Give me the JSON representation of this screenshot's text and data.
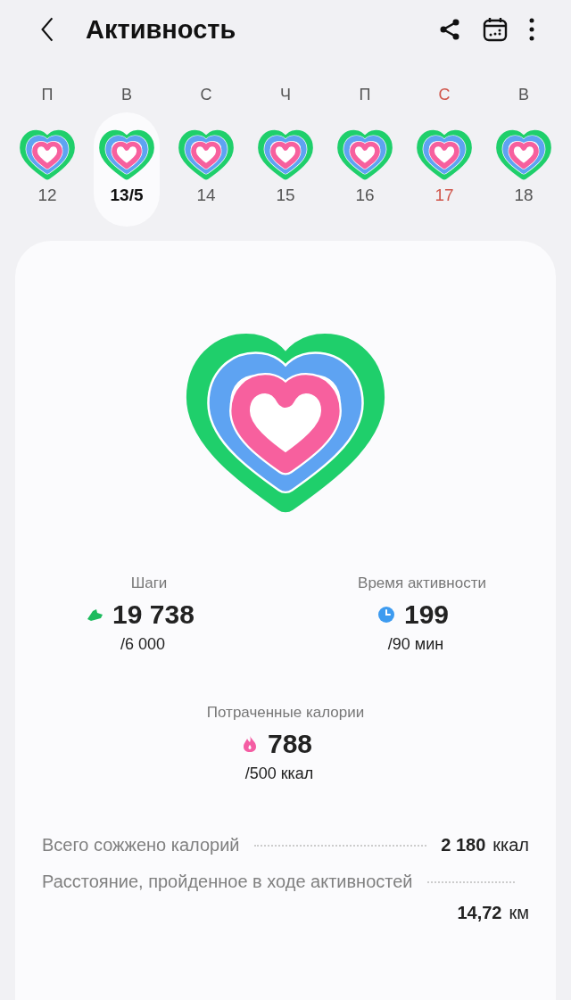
{
  "header": {
    "title": "Активность"
  },
  "days": [
    {
      "letter": "П",
      "date": "12",
      "selected": false,
      "weekend": false
    },
    {
      "letter": "В",
      "date": "13/5",
      "selected": true,
      "weekend": false
    },
    {
      "letter": "С",
      "date": "14",
      "selected": false,
      "weekend": false
    },
    {
      "letter": "Ч",
      "date": "15",
      "selected": false,
      "weekend": false
    },
    {
      "letter": "П",
      "date": "16",
      "selected": false,
      "weekend": false
    },
    {
      "letter": "С",
      "date": "17",
      "selected": false,
      "weekend": true
    },
    {
      "letter": "В",
      "date": "18",
      "selected": false,
      "weekend": false
    }
  ],
  "stats": [
    {
      "kind": "steps",
      "label": "Шаги",
      "value": "19 738",
      "goal": "/6 000"
    },
    {
      "kind": "time",
      "label": "Время активности",
      "value": "199",
      "goal": "/90 мин"
    },
    {
      "kind": "calories",
      "label": "Потраченные калории",
      "value": "788",
      "goal": "/500 ккал"
    }
  ],
  "summary": [
    {
      "label": "Всего сожжено калорий",
      "value": "2 180",
      "unit": "ккал"
    },
    {
      "label": "Расстояние, пройденное в ходе активностей",
      "value": "14,72",
      "unit": "км"
    }
  ]
}
